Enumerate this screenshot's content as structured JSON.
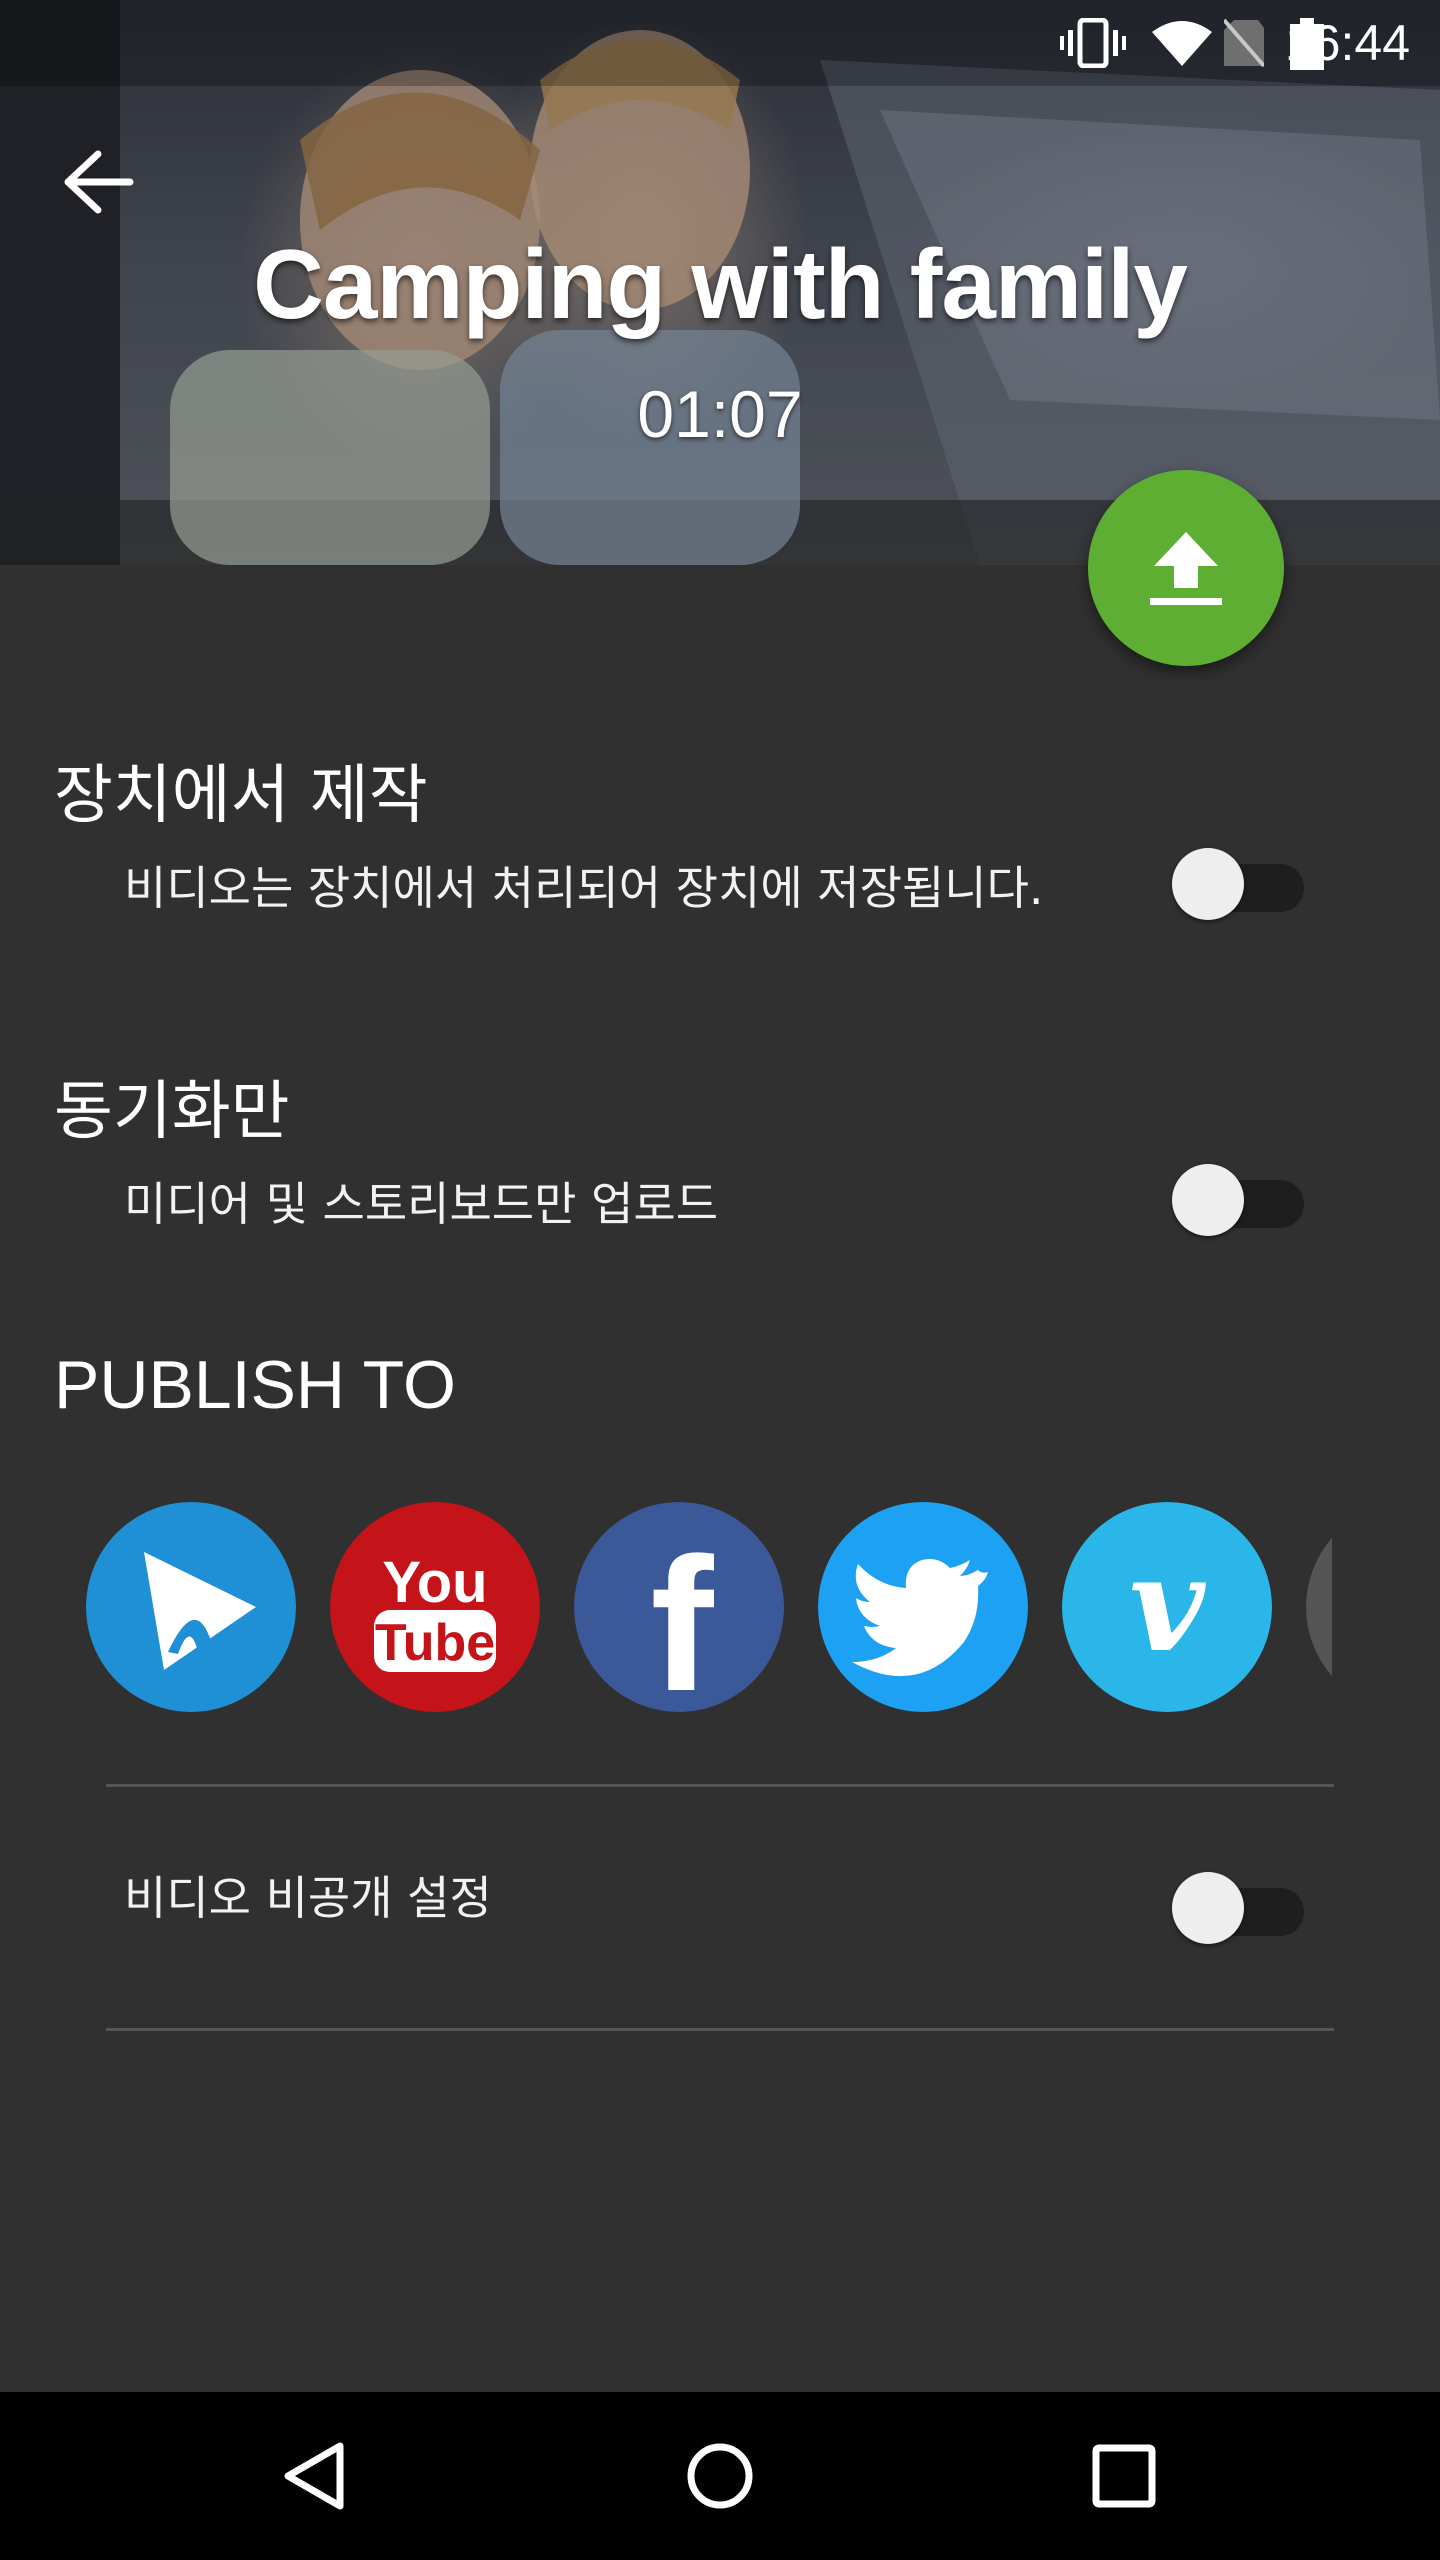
{
  "status_bar": {
    "time": "16:44",
    "icons": [
      "vibrate-icon",
      "wifi-icon",
      "no-sim-icon",
      "battery-icon"
    ]
  },
  "header": {
    "title": "Camping with family",
    "duration": "01:07",
    "back_icon": "back-arrow-icon",
    "upload_icon": "upload-icon",
    "upload_color": "#5fae34"
  },
  "settings": {
    "on_device": {
      "title": "장치에서 제작",
      "description": "비디오는 장치에서 처리되어 장치에 저장됩니다.",
      "enabled": false
    },
    "sync_only": {
      "title": "동기화만",
      "description": "미디어 및 스토리보드만 업로드",
      "enabled": false
    }
  },
  "publish": {
    "title": "PUBLISH TO",
    "services": [
      {
        "name": "app-share",
        "icon": "play-share-icon",
        "color": "#1f8fd6"
      },
      {
        "name": "youtube",
        "icon": "youtube-icon",
        "color": "#c4141a",
        "logo_text_top": "You",
        "logo_text_bottom": "Tube"
      },
      {
        "name": "facebook",
        "icon": "facebook-icon",
        "color": "#3b5998",
        "logo_text": "f"
      },
      {
        "name": "twitter",
        "icon": "twitter-icon",
        "color": "#1da1f2"
      },
      {
        "name": "vimeo",
        "icon": "vimeo-icon",
        "color": "#2bb6e9",
        "logo_text": "v"
      },
      {
        "name": "more",
        "icon": "partial-service-icon",
        "color": "#555555"
      }
    ],
    "private_video": {
      "label": "비디오 비공개 설정",
      "enabled": false
    }
  },
  "navigation": {
    "back": "nav-back-icon",
    "home": "nav-home-icon",
    "recents": "nav-recents-icon"
  }
}
